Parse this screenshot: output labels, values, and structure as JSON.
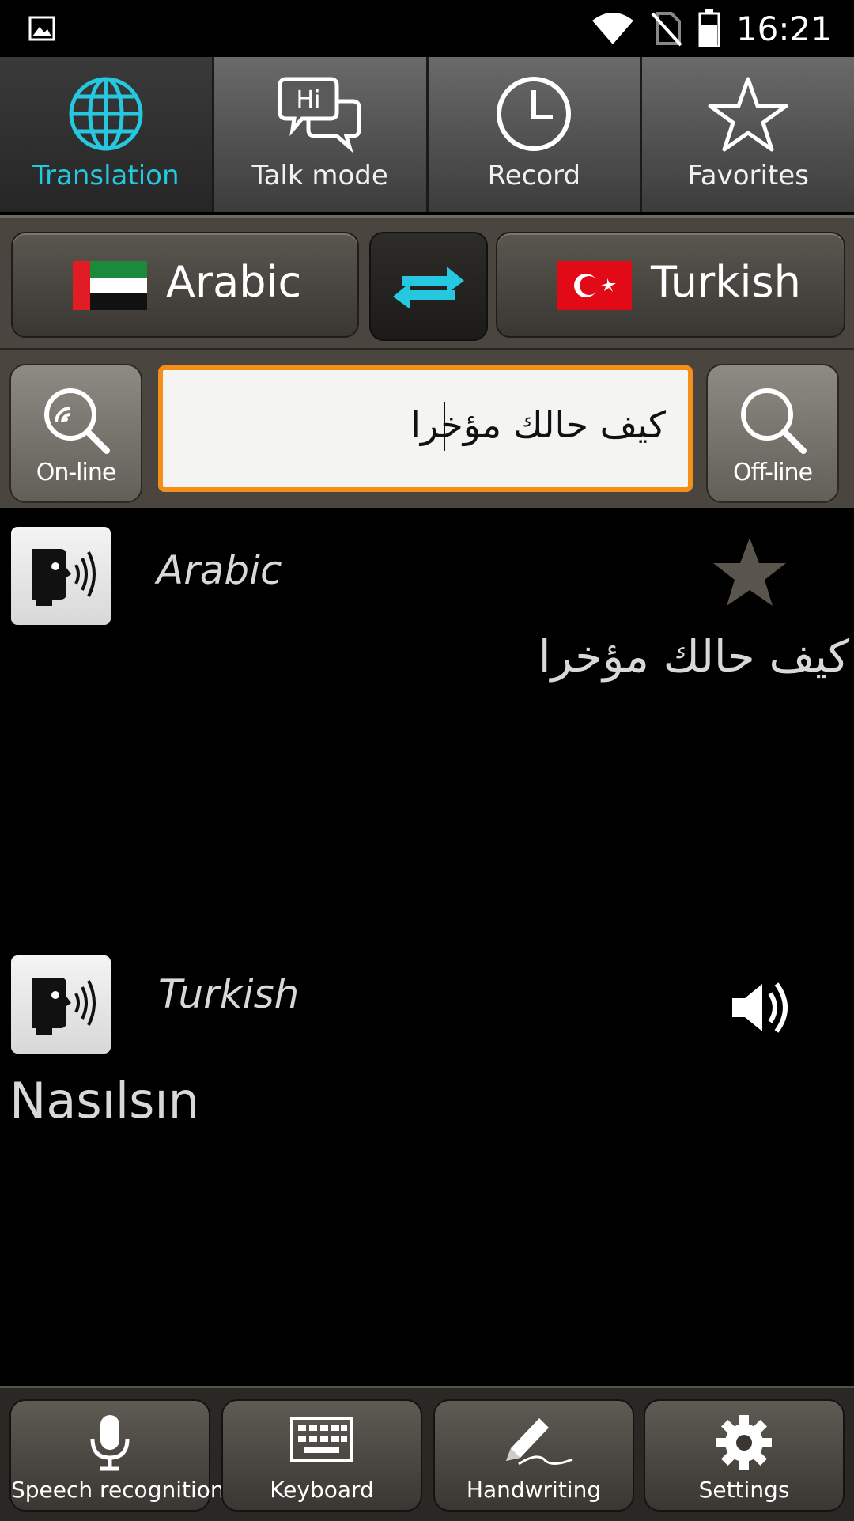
{
  "status": {
    "time": "16:21"
  },
  "tabs": [
    {
      "label": "Translation",
      "icon": "globe-icon",
      "active": true
    },
    {
      "label": "Talk mode",
      "icon": "chat-bubbles-icon"
    },
    {
      "label": "Record",
      "icon": "clock-icon"
    },
    {
      "label": "Favorites",
      "icon": "star-icon"
    }
  ],
  "languages": {
    "source": "Arabic",
    "target": "Turkish"
  },
  "search": {
    "online_label": "On-line",
    "offline_label": "Off-line",
    "input_value": "كيف حالك مؤخرا"
  },
  "result": {
    "source_lang": "Arabic",
    "source_text": "كيف حالك مؤخرا",
    "target_lang": "Turkish",
    "target_text": "Nasılsın"
  },
  "bottom": [
    {
      "label": "Speech recognition",
      "icon": "microphone-icon"
    },
    {
      "label": "Keyboard",
      "icon": "keyboard-icon"
    },
    {
      "label": "Handwriting",
      "icon": "pen-icon"
    },
    {
      "label": "Settings",
      "icon": "gear-icon"
    }
  ],
  "colors": {
    "accent": "#25c8de",
    "input_border": "#f4901a"
  }
}
